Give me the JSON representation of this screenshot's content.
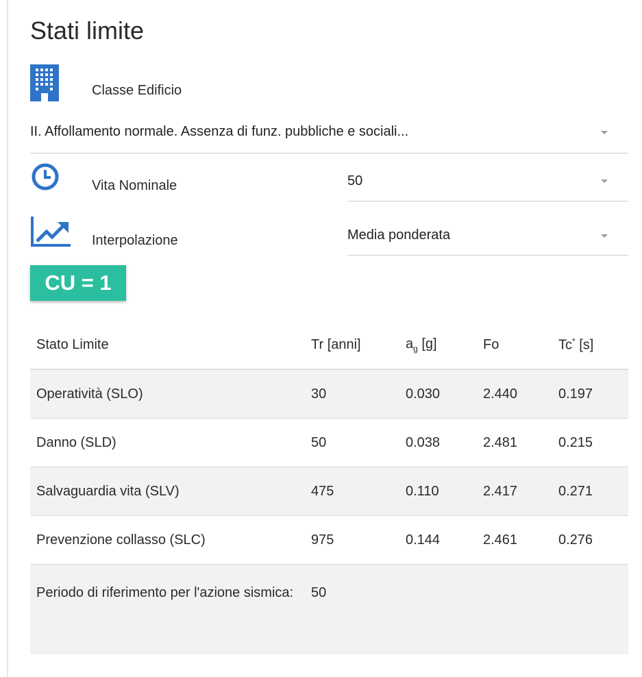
{
  "page": {
    "title": "Stati limite"
  },
  "classe_edificio": {
    "label": "Classe Edificio",
    "value": "II. Affollamento normale. Assenza di funz. pubbliche e sociali...",
    "icon": "building-icon"
  },
  "vita_nominale": {
    "label": "Vita Nominale",
    "value": "50",
    "icon": "clock-icon"
  },
  "interpolazione": {
    "label": "Interpolazione",
    "value": "Media ponderata",
    "icon": "trending-up-icon"
  },
  "cu_badge": "CU = 1",
  "table": {
    "headers": {
      "stato": "Stato Limite",
      "tr": "Tr [anni]",
      "ag_main": "a",
      "ag_sub": "g",
      "ag_unit": " [g]",
      "fo": "Fo",
      "tc_main": "Tc",
      "tc_sup": "*",
      "tc_unit": " [s]"
    },
    "rows": [
      {
        "stato": "Operatività (SLO)",
        "tr": "30",
        "ag": "0.030",
        "fo": "2.440",
        "tc": "0.197"
      },
      {
        "stato": "Danno (SLD)",
        "tr": "50",
        "ag": "0.038",
        "fo": "2.481",
        "tc": "0.215"
      },
      {
        "stato": "Salvaguardia vita (SLV)",
        "tr": "475",
        "ag": "0.110",
        "fo": "2.417",
        "tc": "0.271"
      },
      {
        "stato": "Prevenzione collasso (SLC)",
        "tr": "975",
        "ag": "0.144",
        "fo": "2.461",
        "tc": "0.276"
      }
    ],
    "periodo": {
      "label": "Periodo di riferimento per l'azione sismica:",
      "value": "50"
    }
  },
  "colors": {
    "icon_blue": "#2e74c8",
    "badge_teal": "#2bbf9f",
    "row_grey": "#f2f2f2"
  }
}
